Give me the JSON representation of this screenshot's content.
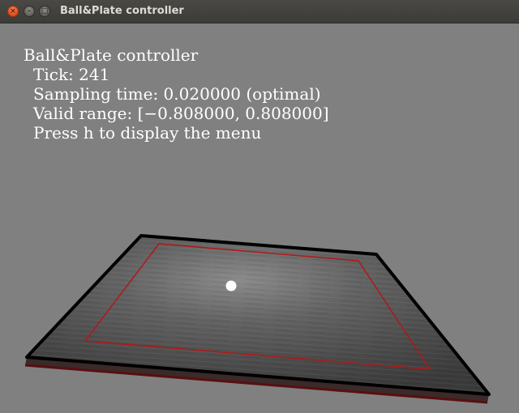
{
  "window": {
    "title": "Ball&Plate controller",
    "controls": [
      "close-icon",
      "minimize-icon",
      "maximize-icon"
    ]
  },
  "hud": {
    "heading": "Ball&Plate controller",
    "tick": "Tick: 241",
    "sampling_time": "Sampling time: 0.020000 (optimal)",
    "valid_range": "Valid range: [−0.808000, 0.808000]",
    "hint": "Press h to display the menu"
  },
  "colors": {
    "background": "#808080",
    "plate_edge": "#000000",
    "valid_range_outline": "#b01818",
    "ball": "#ffffff"
  }
}
